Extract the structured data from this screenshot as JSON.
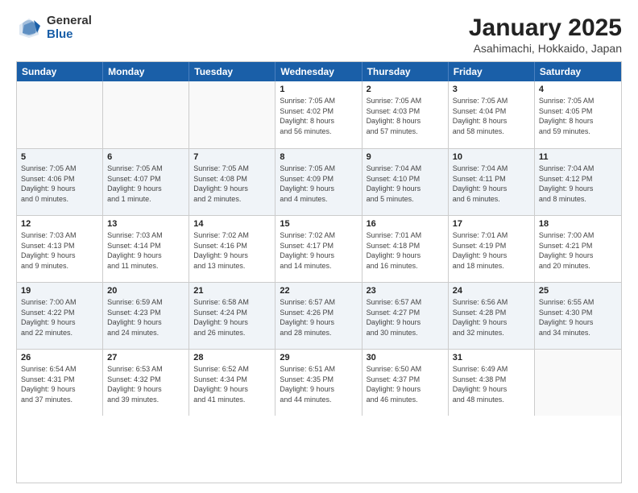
{
  "logo": {
    "general": "General",
    "blue": "Blue"
  },
  "title": "January 2025",
  "location": "Asahimachi, Hokkaido, Japan",
  "days_header": [
    "Sunday",
    "Monday",
    "Tuesday",
    "Wednesday",
    "Thursday",
    "Friday",
    "Saturday"
  ],
  "weeks": [
    [
      {
        "day": "",
        "info": ""
      },
      {
        "day": "",
        "info": ""
      },
      {
        "day": "",
        "info": ""
      },
      {
        "day": "1",
        "info": "Sunrise: 7:05 AM\nSunset: 4:02 PM\nDaylight: 8 hours\nand 56 minutes."
      },
      {
        "day": "2",
        "info": "Sunrise: 7:05 AM\nSunset: 4:03 PM\nDaylight: 8 hours\nand 57 minutes."
      },
      {
        "day": "3",
        "info": "Sunrise: 7:05 AM\nSunset: 4:04 PM\nDaylight: 8 hours\nand 58 minutes."
      },
      {
        "day": "4",
        "info": "Sunrise: 7:05 AM\nSunset: 4:05 PM\nDaylight: 8 hours\nand 59 minutes."
      }
    ],
    [
      {
        "day": "5",
        "info": "Sunrise: 7:05 AM\nSunset: 4:06 PM\nDaylight: 9 hours\nand 0 minutes."
      },
      {
        "day": "6",
        "info": "Sunrise: 7:05 AM\nSunset: 4:07 PM\nDaylight: 9 hours\nand 1 minute."
      },
      {
        "day": "7",
        "info": "Sunrise: 7:05 AM\nSunset: 4:08 PM\nDaylight: 9 hours\nand 2 minutes."
      },
      {
        "day": "8",
        "info": "Sunrise: 7:05 AM\nSunset: 4:09 PM\nDaylight: 9 hours\nand 4 minutes."
      },
      {
        "day": "9",
        "info": "Sunrise: 7:04 AM\nSunset: 4:10 PM\nDaylight: 9 hours\nand 5 minutes."
      },
      {
        "day": "10",
        "info": "Sunrise: 7:04 AM\nSunset: 4:11 PM\nDaylight: 9 hours\nand 6 minutes."
      },
      {
        "day": "11",
        "info": "Sunrise: 7:04 AM\nSunset: 4:12 PM\nDaylight: 9 hours\nand 8 minutes."
      }
    ],
    [
      {
        "day": "12",
        "info": "Sunrise: 7:03 AM\nSunset: 4:13 PM\nDaylight: 9 hours\nand 9 minutes."
      },
      {
        "day": "13",
        "info": "Sunrise: 7:03 AM\nSunset: 4:14 PM\nDaylight: 9 hours\nand 11 minutes."
      },
      {
        "day": "14",
        "info": "Sunrise: 7:02 AM\nSunset: 4:16 PM\nDaylight: 9 hours\nand 13 minutes."
      },
      {
        "day": "15",
        "info": "Sunrise: 7:02 AM\nSunset: 4:17 PM\nDaylight: 9 hours\nand 14 minutes."
      },
      {
        "day": "16",
        "info": "Sunrise: 7:01 AM\nSunset: 4:18 PM\nDaylight: 9 hours\nand 16 minutes."
      },
      {
        "day": "17",
        "info": "Sunrise: 7:01 AM\nSunset: 4:19 PM\nDaylight: 9 hours\nand 18 minutes."
      },
      {
        "day": "18",
        "info": "Sunrise: 7:00 AM\nSunset: 4:21 PM\nDaylight: 9 hours\nand 20 minutes."
      }
    ],
    [
      {
        "day": "19",
        "info": "Sunrise: 7:00 AM\nSunset: 4:22 PM\nDaylight: 9 hours\nand 22 minutes."
      },
      {
        "day": "20",
        "info": "Sunrise: 6:59 AM\nSunset: 4:23 PM\nDaylight: 9 hours\nand 24 minutes."
      },
      {
        "day": "21",
        "info": "Sunrise: 6:58 AM\nSunset: 4:24 PM\nDaylight: 9 hours\nand 26 minutes."
      },
      {
        "day": "22",
        "info": "Sunrise: 6:57 AM\nSunset: 4:26 PM\nDaylight: 9 hours\nand 28 minutes."
      },
      {
        "day": "23",
        "info": "Sunrise: 6:57 AM\nSunset: 4:27 PM\nDaylight: 9 hours\nand 30 minutes."
      },
      {
        "day": "24",
        "info": "Sunrise: 6:56 AM\nSunset: 4:28 PM\nDaylight: 9 hours\nand 32 minutes."
      },
      {
        "day": "25",
        "info": "Sunrise: 6:55 AM\nSunset: 4:30 PM\nDaylight: 9 hours\nand 34 minutes."
      }
    ],
    [
      {
        "day": "26",
        "info": "Sunrise: 6:54 AM\nSunset: 4:31 PM\nDaylight: 9 hours\nand 37 minutes."
      },
      {
        "day": "27",
        "info": "Sunrise: 6:53 AM\nSunset: 4:32 PM\nDaylight: 9 hours\nand 39 minutes."
      },
      {
        "day": "28",
        "info": "Sunrise: 6:52 AM\nSunset: 4:34 PM\nDaylight: 9 hours\nand 41 minutes."
      },
      {
        "day": "29",
        "info": "Sunrise: 6:51 AM\nSunset: 4:35 PM\nDaylight: 9 hours\nand 44 minutes."
      },
      {
        "day": "30",
        "info": "Sunrise: 6:50 AM\nSunset: 4:37 PM\nDaylight: 9 hours\nand 46 minutes."
      },
      {
        "day": "31",
        "info": "Sunrise: 6:49 AM\nSunset: 4:38 PM\nDaylight: 9 hours\nand 48 minutes."
      },
      {
        "day": "",
        "info": ""
      }
    ]
  ]
}
